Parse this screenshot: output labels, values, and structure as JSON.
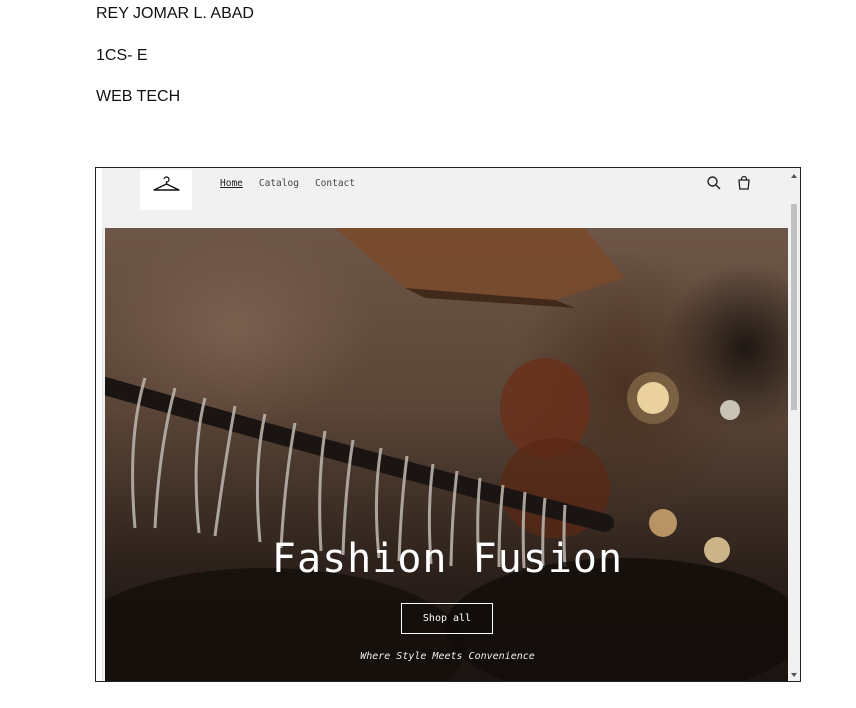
{
  "document": {
    "name": "REY JOMAR L. ABAD",
    "section": "1CS- E",
    "subject": "WEB TECH"
  },
  "site": {
    "nav": [
      {
        "label": "Home",
        "active": true
      },
      {
        "label": "Catalog",
        "active": false
      },
      {
        "label": "Contact",
        "active": false
      }
    ],
    "icons": [
      "hanger-logo-icon",
      "search-icon",
      "cart-icon"
    ],
    "hero": {
      "title": "Fashion Fusion",
      "button_label": "Shop all",
      "tagline": "Where Style Meets Convenience"
    }
  }
}
